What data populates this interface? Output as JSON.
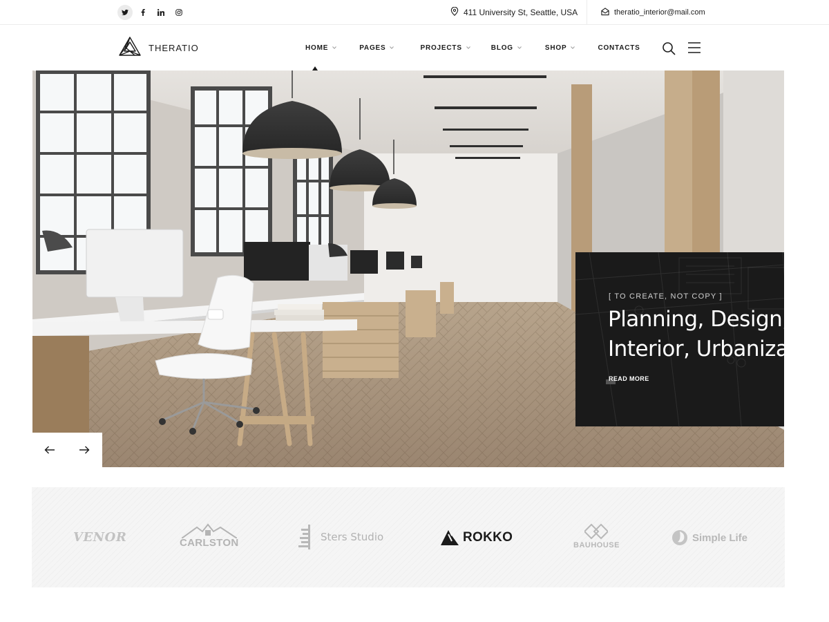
{
  "topbar": {
    "social": [
      {
        "icon": "twitter-icon",
        "glyph": "🐦"
      },
      {
        "icon": "facebook-icon",
        "glyph": "f"
      },
      {
        "icon": "linkedin-icon",
        "glyph": "in"
      },
      {
        "icon": "instagram-icon",
        "glyph": ""
      }
    ],
    "address": "411 University St, Seattle, USA",
    "email": "theratio_interior@mail.com"
  },
  "header": {
    "logo_text": "THERATIO",
    "nav": [
      {
        "label": "HOME",
        "has_dropdown": true,
        "active": true
      },
      {
        "label": "PAGES",
        "has_dropdown": true
      },
      {
        "label": "PROJECTS",
        "has_dropdown": true
      },
      {
        "label": "BLOG",
        "has_dropdown": true
      },
      {
        "label": "SHOP",
        "has_dropdown": true
      },
      {
        "label": "CONTACTS",
        "has_dropdown": false
      }
    ]
  },
  "hero": {
    "eyebrow": "[ TO CREATE, NOT COPY ]",
    "headline": "Planning, Design, Interior, Urbanization",
    "read_more": "READ MORE"
  },
  "clients": [
    {
      "name": "VENOR"
    },
    {
      "name": "CARLSTON"
    },
    {
      "name": "Sters Studio"
    },
    {
      "name": "ROKKO"
    },
    {
      "name": "BAUHOUSE"
    },
    {
      "name": "Simple Life"
    }
  ],
  "colors": {
    "dark": "#1a1a1a",
    "text": "#1b1b1b",
    "muted": "#b2b2b2",
    "strip_bg": "#f5f5f5"
  }
}
